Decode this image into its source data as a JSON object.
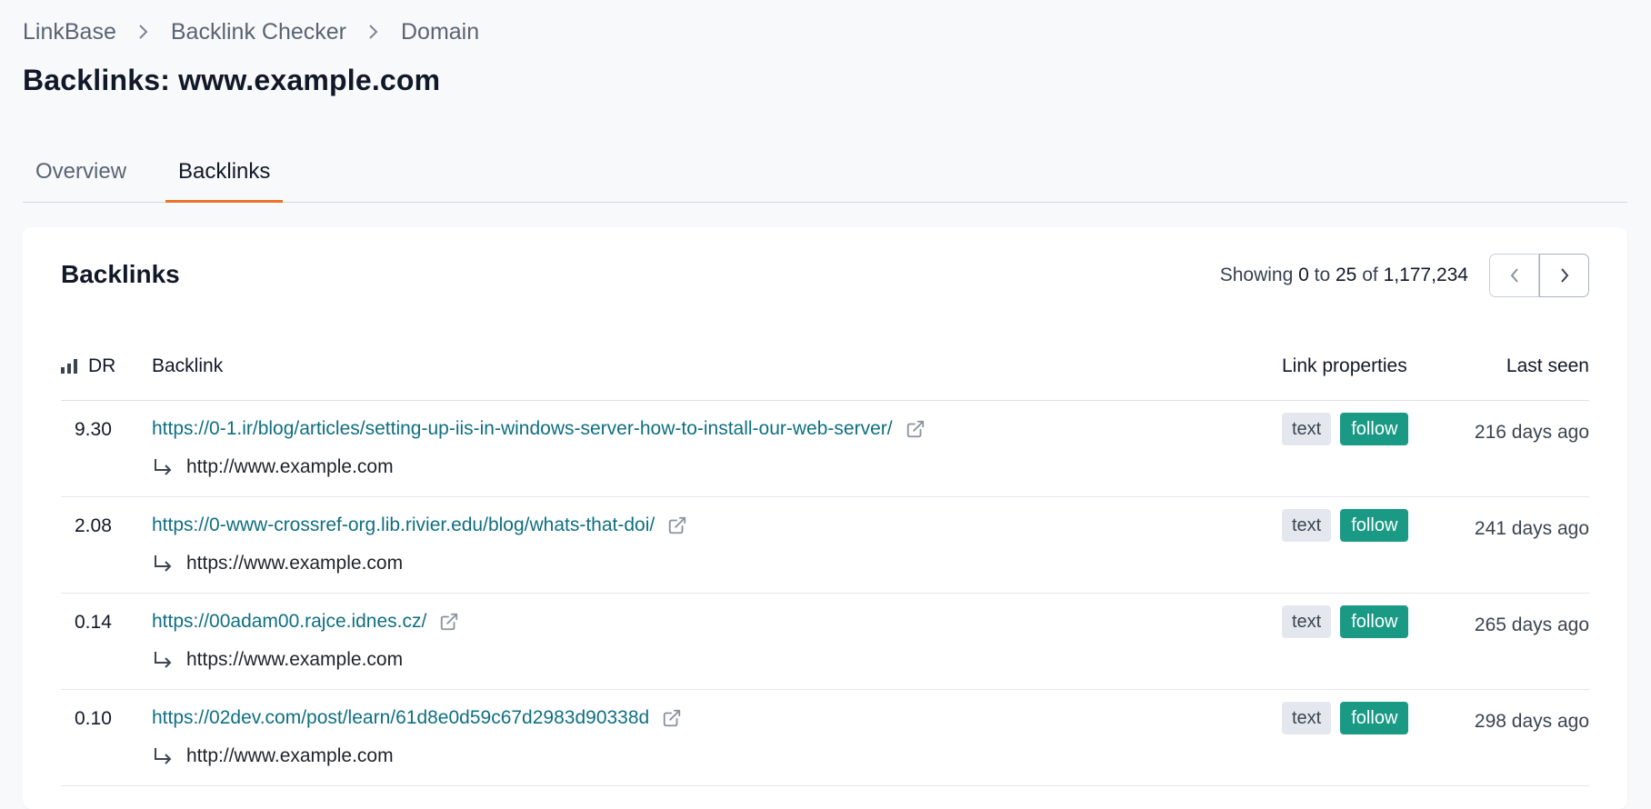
{
  "breadcrumb": [
    "LinkBase",
    "Backlink Checker",
    "Domain"
  ],
  "page_title": "Backlinks: www.example.com",
  "tabs": [
    {
      "label": "Overview",
      "active": false
    },
    {
      "label": "Backlinks",
      "active": true
    }
  ],
  "card": {
    "title": "Backlinks",
    "showing": {
      "prefix": "Showing",
      "from": "0",
      "to_word": "to",
      "to": "25",
      "of_word": "of",
      "total": "1,177,234"
    }
  },
  "table": {
    "headers": {
      "dr": "DR",
      "backlink": "Backlink",
      "props": "Link properties",
      "seen": "Last seen"
    },
    "rows": [
      {
        "dr": "9.30",
        "url": "https://0-1.ir/blog/articles/setting-up-iis-in-windows-server-how-to-install-our-web-server/",
        "target": "http://www.example.com",
        "badge_text": "text",
        "badge_follow": "follow",
        "last_seen": "216 days ago"
      },
      {
        "dr": "2.08",
        "url": "https://0-www-crossref-org.lib.rivier.edu/blog/whats-that-doi/",
        "target": "https://www.example.com",
        "badge_text": "text",
        "badge_follow": "follow",
        "last_seen": "241 days ago"
      },
      {
        "dr": "0.14",
        "url": "https://00adam00.rajce.idnes.cz/",
        "target": "https://www.example.com",
        "badge_text": "text",
        "badge_follow": "follow",
        "last_seen": "265 days ago"
      },
      {
        "dr": "0.10",
        "url": "https://02dev.com/post/learn/61d8e0d59c67d2983d90338d",
        "target": "http://www.example.com",
        "badge_text": "text",
        "badge_follow": "follow",
        "last_seen": "298 days ago"
      }
    ]
  },
  "colors": {
    "accent_tab": "#e8742a",
    "link": "#0f6f82",
    "follow_badge": "#1a9a85",
    "text_badge": "#e4e8ee"
  },
  "icons": [
    "chevron-right-icon",
    "chevron-left-icon",
    "bar-chart-icon",
    "external-link-icon",
    "return-arrow-icon"
  ]
}
